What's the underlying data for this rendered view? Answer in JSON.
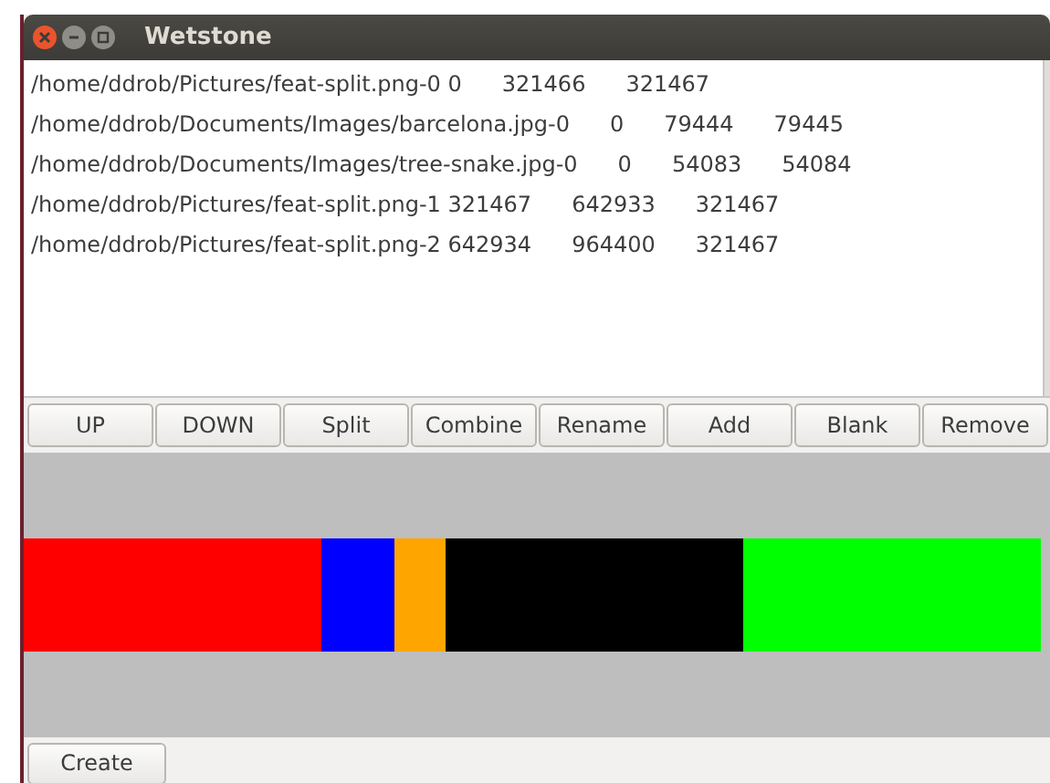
{
  "window": {
    "title": "Wetstone"
  },
  "files": [
    {
      "cells": [
        "/home/ddrob/Pictures/feat-split.png-0 0",
        "321466",
        "321467"
      ]
    },
    {
      "cells": [
        "/home/ddrob/Documents/Images/barcelona.jpg-0",
        "0",
        "79444",
        "79445"
      ]
    },
    {
      "cells": [
        "/home/ddrob/Documents/Images/tree-snake.jpg-0",
        "0",
        "54083",
        "54084"
      ]
    },
    {
      "cells": [
        "/home/ddrob/Pictures/feat-split.png-1 321467",
        "642933",
        "321467"
      ]
    },
    {
      "cells": [
        "/home/ddrob/Pictures/feat-split.png-2 642934",
        "964400",
        "321467"
      ]
    }
  ],
  "buttons": [
    "UP",
    "DOWN",
    "Split",
    "Combine",
    "Rename",
    "Add",
    "Blank",
    "Remove"
  ],
  "segments": [
    {
      "color": "#ff0000"
    },
    {
      "color": "#0000ff"
    },
    {
      "color": "#ffa500"
    },
    {
      "color": "#000000"
    },
    {
      "color": "#00ff00"
    }
  ],
  "create_button": "Create"
}
